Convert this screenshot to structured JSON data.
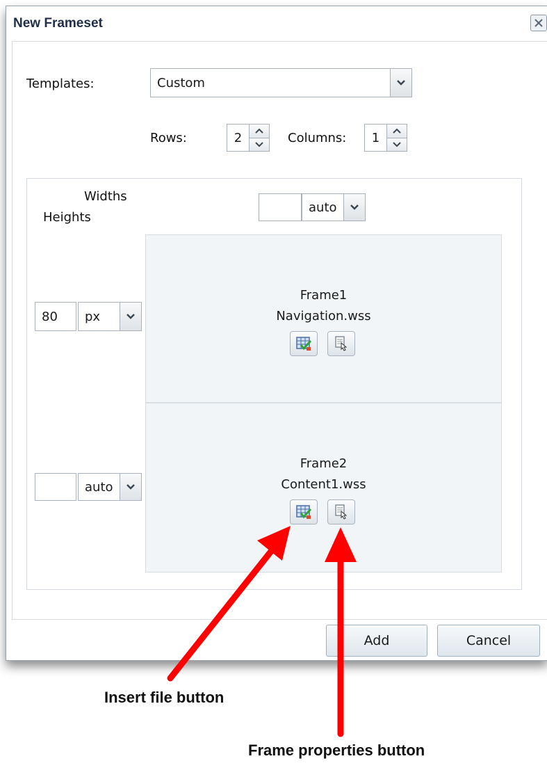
{
  "dialog": {
    "title": "New Frameset",
    "close_icon": "close-icon"
  },
  "templates": {
    "label": "Templates:",
    "selected": "Custom"
  },
  "grid": {
    "rows_label": "Rows:",
    "rows_value": "2",
    "columns_label": "Columns:",
    "columns_value": "1"
  },
  "layout": {
    "widths_label": "Widths",
    "heights_label": "Heights",
    "column_width": {
      "value": "",
      "unit": "auto"
    },
    "row_heights": [
      {
        "value": "80",
        "unit": "px"
      },
      {
        "value": "",
        "unit": "auto"
      }
    ]
  },
  "frames": [
    {
      "name": "Frame1",
      "file": "Navigation.wss",
      "insert_icon": "insert-file-icon",
      "props_icon": "frame-properties-icon"
    },
    {
      "name": "Frame2",
      "file": "Content1.wss",
      "insert_icon": "insert-file-icon",
      "props_icon": "frame-properties-icon"
    }
  ],
  "footer": {
    "add_label": "Add",
    "cancel_label": "Cancel"
  },
  "annotations": {
    "insert_file": "Insert file button",
    "frame_properties": "Frame properties button",
    "arrow_color": "#ff0000"
  }
}
